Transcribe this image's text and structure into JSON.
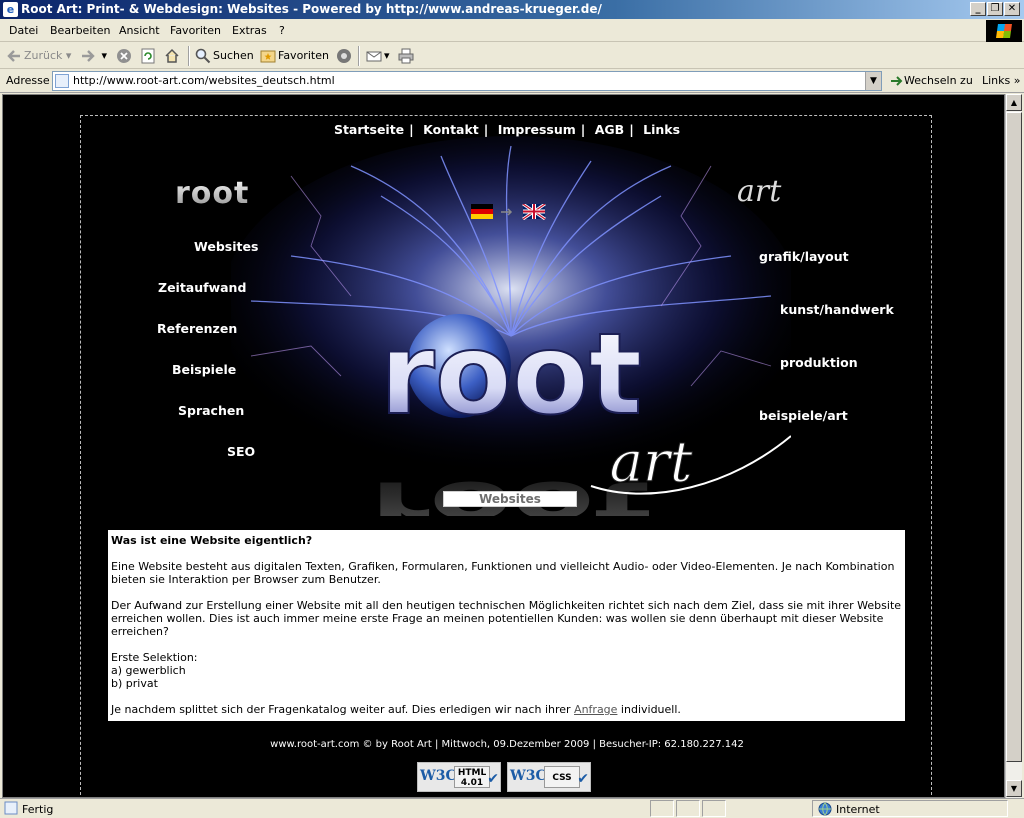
{
  "window": {
    "title": "Root Art: Print- & Webdesign: Websites - Powered by http://www.andreas-krueger.de/"
  },
  "menu": [
    "Datei",
    "Bearbeiten",
    "Ansicht",
    "Favoriten",
    "Extras",
    "?"
  ],
  "toolbar": {
    "back": "Zurück",
    "search": "Suchen",
    "favorites": "Favoriten"
  },
  "address": {
    "label": "Adresse",
    "url": "http://www.root-art.com/websites_deutsch.html",
    "go": "Wechseln zu",
    "links": "Links"
  },
  "page": {
    "topnav": [
      "Startseite",
      "Kontakt",
      "Impressum",
      "AGB",
      "Links"
    ],
    "logo_left": "root",
    "logo_right": "art",
    "left_nav": [
      "Websites",
      "Zeitaufwand",
      "Referenzen",
      "Beispiele",
      "Sprachen",
      "SEO"
    ],
    "right_nav": [
      "grafik/layout",
      "kunst/handwerk",
      "produktion",
      "beispiele/art"
    ],
    "caption": "Websites",
    "content": {
      "heading": "Was ist eine Website eigentlich?",
      "p1": "Eine Website besteht aus digitalen Texten, Grafiken, Formularen, Funktionen und vielleicht Audio- oder Video-Elementen. Je nach Kombination bieten sie Interaktion per Browser zum Benutzer.",
      "p2": "Der Aufwand zur Erstellung einer Website mit all den heutigen technischen Möglichkeiten richtet sich nach dem Ziel, dass sie mit ihrer Website erreichen wollen. Dies ist auch immer meine erste Frage an meinen potentiellen Kunden: was wollen sie denn überhaupt mit dieser Website erreichen?",
      "sel_title": "Erste Selektion:",
      "sel_a": "a) gewerblich",
      "sel_b": "b) privat",
      "p3_before": "Je nachdem splittet sich der Fragenkatalog weiter auf. Dies erledigen wir nach ihrer ",
      "p3_link": "Anfrage",
      "p3_after": " individuell."
    },
    "footer": "www.root-art.com © by Root Art | Mittwoch, 09.Dezember 2009 | Besucher-IP: 62.180.227.142",
    "w3c_html": {
      "logo": "W3C",
      "tag": "HTML 4.01"
    },
    "w3c_css": {
      "logo": "W3C",
      "tag": "CSS"
    },
    "art_text_big": "root",
    "art_text_script": "art"
  },
  "status": {
    "left": "Fertig",
    "zone": "Internet"
  }
}
